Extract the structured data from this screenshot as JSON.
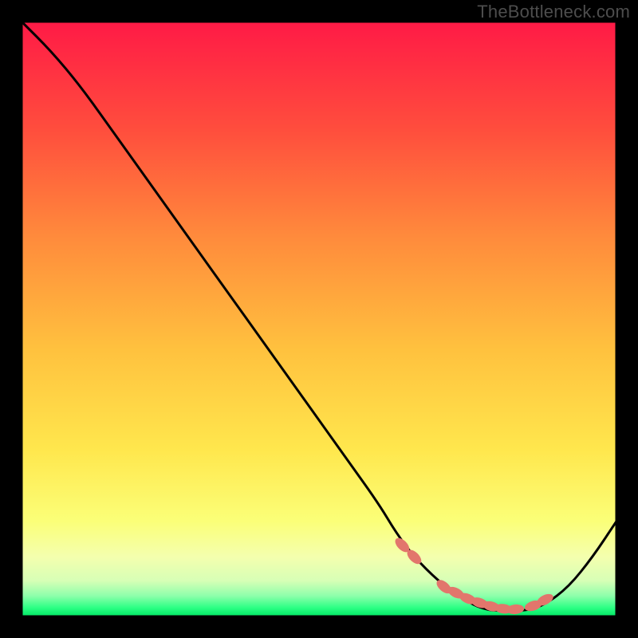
{
  "watermark": "TheBottleneck.com",
  "colors": {
    "page_bg": "#000000",
    "axis": "#000000",
    "curve": "#000000",
    "marker_fill": "#e2766c",
    "gradient_top": "#ff1744",
    "gradient_mid1": "#ff7a3a",
    "gradient_mid2": "#ffd740",
    "gradient_mid3": "#fff176",
    "gradient_band": "#faffb0",
    "gradient_bottom": "#00e676"
  },
  "chart_data": {
    "type": "line",
    "title": "",
    "xlabel": "",
    "ylabel": "",
    "xlim": [
      0,
      100
    ],
    "ylim": [
      0,
      100
    ],
    "series": [
      {
        "name": "bottleneck-curve",
        "x": [
          0,
          5,
          10,
          15,
          20,
          25,
          30,
          35,
          40,
          45,
          50,
          55,
          60,
          63,
          66,
          70,
          74,
          78,
          82,
          85,
          88,
          92,
          96,
          100
        ],
        "y": [
          100,
          95,
          89,
          82,
          75,
          68,
          61,
          54,
          47,
          40,
          33,
          26,
          19,
          14,
          10,
          6,
          3,
          1,
          1,
          1,
          2,
          5,
          10,
          16
        ]
      }
    ],
    "markers": {
      "name": "highlight-dots",
      "x": [
        64,
        66,
        71,
        73,
        75,
        77,
        79,
        81,
        83,
        86,
        88
      ],
      "y": [
        12,
        10,
        5,
        4,
        3,
        2.3,
        1.7,
        1.3,
        1.2,
        1.8,
        2.8
      ]
    },
    "gradient_stops": [
      {
        "offset": 0.0,
        "color": "#ff1a46"
      },
      {
        "offset": 0.18,
        "color": "#ff4d3d"
      },
      {
        "offset": 0.36,
        "color": "#ff8a3c"
      },
      {
        "offset": 0.55,
        "color": "#ffc13e"
      },
      {
        "offset": 0.72,
        "color": "#ffe74d"
      },
      {
        "offset": 0.84,
        "color": "#fbff78"
      },
      {
        "offset": 0.9,
        "color": "#f4ffae"
      },
      {
        "offset": 0.94,
        "color": "#d7ffb6"
      },
      {
        "offset": 0.965,
        "color": "#8fffab"
      },
      {
        "offset": 0.985,
        "color": "#2dff85"
      },
      {
        "offset": 1.0,
        "color": "#00e864"
      }
    ]
  }
}
